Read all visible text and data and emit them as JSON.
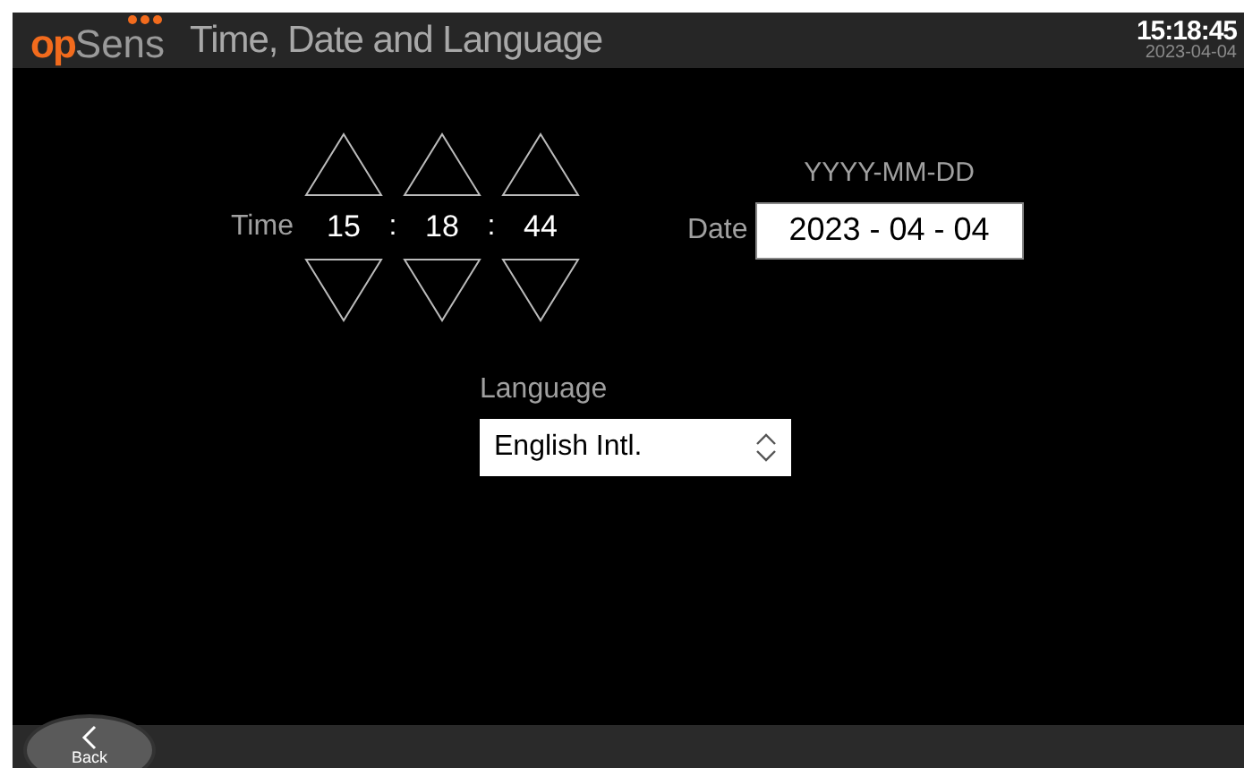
{
  "header": {
    "logo": {
      "prefix": "op",
      "suffix": "Sens"
    },
    "title": "Time, Date and Language",
    "clock": {
      "time": "15:18:45",
      "date": "2023-04-04"
    }
  },
  "time": {
    "label": "Time",
    "fields": [
      {
        "value": "15"
      },
      {
        "value": "18"
      },
      {
        "value": "44"
      }
    ],
    "separators": [
      ":",
      ":"
    ]
  },
  "date": {
    "format_hint": "YYYY-MM-DD",
    "label": "Date",
    "value": "2023 - 04 - 04"
  },
  "language": {
    "label": "Language",
    "value": "English Intl."
  },
  "footer": {
    "back_button": {
      "label": "Back"
    }
  }
}
